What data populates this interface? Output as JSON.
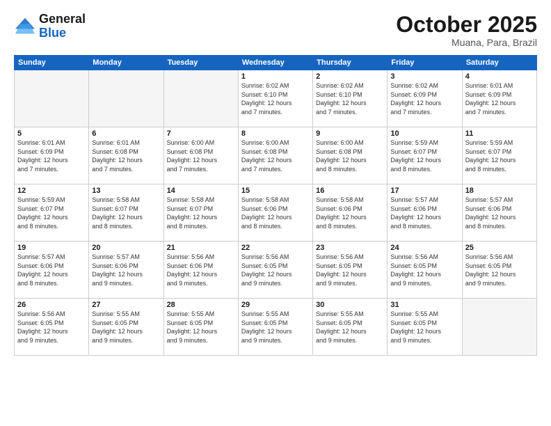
{
  "header": {
    "logo_general": "General",
    "logo_blue": "Blue",
    "month_title": "October 2025",
    "subtitle": "Muana, Para, Brazil"
  },
  "weekdays": [
    "Sunday",
    "Monday",
    "Tuesday",
    "Wednesday",
    "Thursday",
    "Friday",
    "Saturday"
  ],
  "weeks": [
    [
      {
        "day": "",
        "info": ""
      },
      {
        "day": "",
        "info": ""
      },
      {
        "day": "",
        "info": ""
      },
      {
        "day": "1",
        "info": "Sunrise: 6:02 AM\nSunset: 6:10 PM\nDaylight: 12 hours\nand 7 minutes."
      },
      {
        "day": "2",
        "info": "Sunrise: 6:02 AM\nSunset: 6:10 PM\nDaylight: 12 hours\nand 7 minutes."
      },
      {
        "day": "3",
        "info": "Sunrise: 6:02 AM\nSunset: 6:09 PM\nDaylight: 12 hours\nand 7 minutes."
      },
      {
        "day": "4",
        "info": "Sunrise: 6:01 AM\nSunset: 6:09 PM\nDaylight: 12 hours\nand 7 minutes."
      }
    ],
    [
      {
        "day": "5",
        "info": "Sunrise: 6:01 AM\nSunset: 6:09 PM\nDaylight: 12 hours\nand 7 minutes."
      },
      {
        "day": "6",
        "info": "Sunrise: 6:01 AM\nSunset: 6:08 PM\nDaylight: 12 hours\nand 7 minutes."
      },
      {
        "day": "7",
        "info": "Sunrise: 6:00 AM\nSunset: 6:08 PM\nDaylight: 12 hours\nand 7 minutes."
      },
      {
        "day": "8",
        "info": "Sunrise: 6:00 AM\nSunset: 6:08 PM\nDaylight: 12 hours\nand 7 minutes."
      },
      {
        "day": "9",
        "info": "Sunrise: 6:00 AM\nSunset: 6:08 PM\nDaylight: 12 hours\nand 8 minutes."
      },
      {
        "day": "10",
        "info": "Sunrise: 5:59 AM\nSunset: 6:07 PM\nDaylight: 12 hours\nand 8 minutes."
      },
      {
        "day": "11",
        "info": "Sunrise: 5:59 AM\nSunset: 6:07 PM\nDaylight: 12 hours\nand 8 minutes."
      }
    ],
    [
      {
        "day": "12",
        "info": "Sunrise: 5:59 AM\nSunset: 6:07 PM\nDaylight: 12 hours\nand 8 minutes."
      },
      {
        "day": "13",
        "info": "Sunrise: 5:58 AM\nSunset: 6:07 PM\nDaylight: 12 hours\nand 8 minutes."
      },
      {
        "day": "14",
        "info": "Sunrise: 5:58 AM\nSunset: 6:07 PM\nDaylight: 12 hours\nand 8 minutes."
      },
      {
        "day": "15",
        "info": "Sunrise: 5:58 AM\nSunset: 6:06 PM\nDaylight: 12 hours\nand 8 minutes."
      },
      {
        "day": "16",
        "info": "Sunrise: 5:58 AM\nSunset: 6:06 PM\nDaylight: 12 hours\nand 8 minutes."
      },
      {
        "day": "17",
        "info": "Sunrise: 5:57 AM\nSunset: 6:06 PM\nDaylight: 12 hours\nand 8 minutes."
      },
      {
        "day": "18",
        "info": "Sunrise: 5:57 AM\nSunset: 6:06 PM\nDaylight: 12 hours\nand 8 minutes."
      }
    ],
    [
      {
        "day": "19",
        "info": "Sunrise: 5:57 AM\nSunset: 6:06 PM\nDaylight: 12 hours\nand 8 minutes."
      },
      {
        "day": "20",
        "info": "Sunrise: 5:57 AM\nSunset: 6:06 PM\nDaylight: 12 hours\nand 9 minutes."
      },
      {
        "day": "21",
        "info": "Sunrise: 5:56 AM\nSunset: 6:06 PM\nDaylight: 12 hours\nand 9 minutes."
      },
      {
        "day": "22",
        "info": "Sunrise: 5:56 AM\nSunset: 6:05 PM\nDaylight: 12 hours\nand 9 minutes."
      },
      {
        "day": "23",
        "info": "Sunrise: 5:56 AM\nSunset: 6:05 PM\nDaylight: 12 hours\nand 9 minutes."
      },
      {
        "day": "24",
        "info": "Sunrise: 5:56 AM\nSunset: 6:05 PM\nDaylight: 12 hours\nand 9 minutes."
      },
      {
        "day": "25",
        "info": "Sunrise: 5:56 AM\nSunset: 6:05 PM\nDaylight: 12 hours\nand 9 minutes."
      }
    ],
    [
      {
        "day": "26",
        "info": "Sunrise: 5:56 AM\nSunset: 6:05 PM\nDaylight: 12 hours\nand 9 minutes."
      },
      {
        "day": "27",
        "info": "Sunrise: 5:55 AM\nSunset: 6:05 PM\nDaylight: 12 hours\nand 9 minutes."
      },
      {
        "day": "28",
        "info": "Sunrise: 5:55 AM\nSunset: 6:05 PM\nDaylight: 12 hours\nand 9 minutes."
      },
      {
        "day": "29",
        "info": "Sunrise: 5:55 AM\nSunset: 6:05 PM\nDaylight: 12 hours\nand 9 minutes."
      },
      {
        "day": "30",
        "info": "Sunrise: 5:55 AM\nSunset: 6:05 PM\nDaylight: 12 hours\nand 9 minutes."
      },
      {
        "day": "31",
        "info": "Sunrise: 5:55 AM\nSunset: 6:05 PM\nDaylight: 12 hours\nand 9 minutes."
      },
      {
        "day": "",
        "info": ""
      }
    ]
  ]
}
